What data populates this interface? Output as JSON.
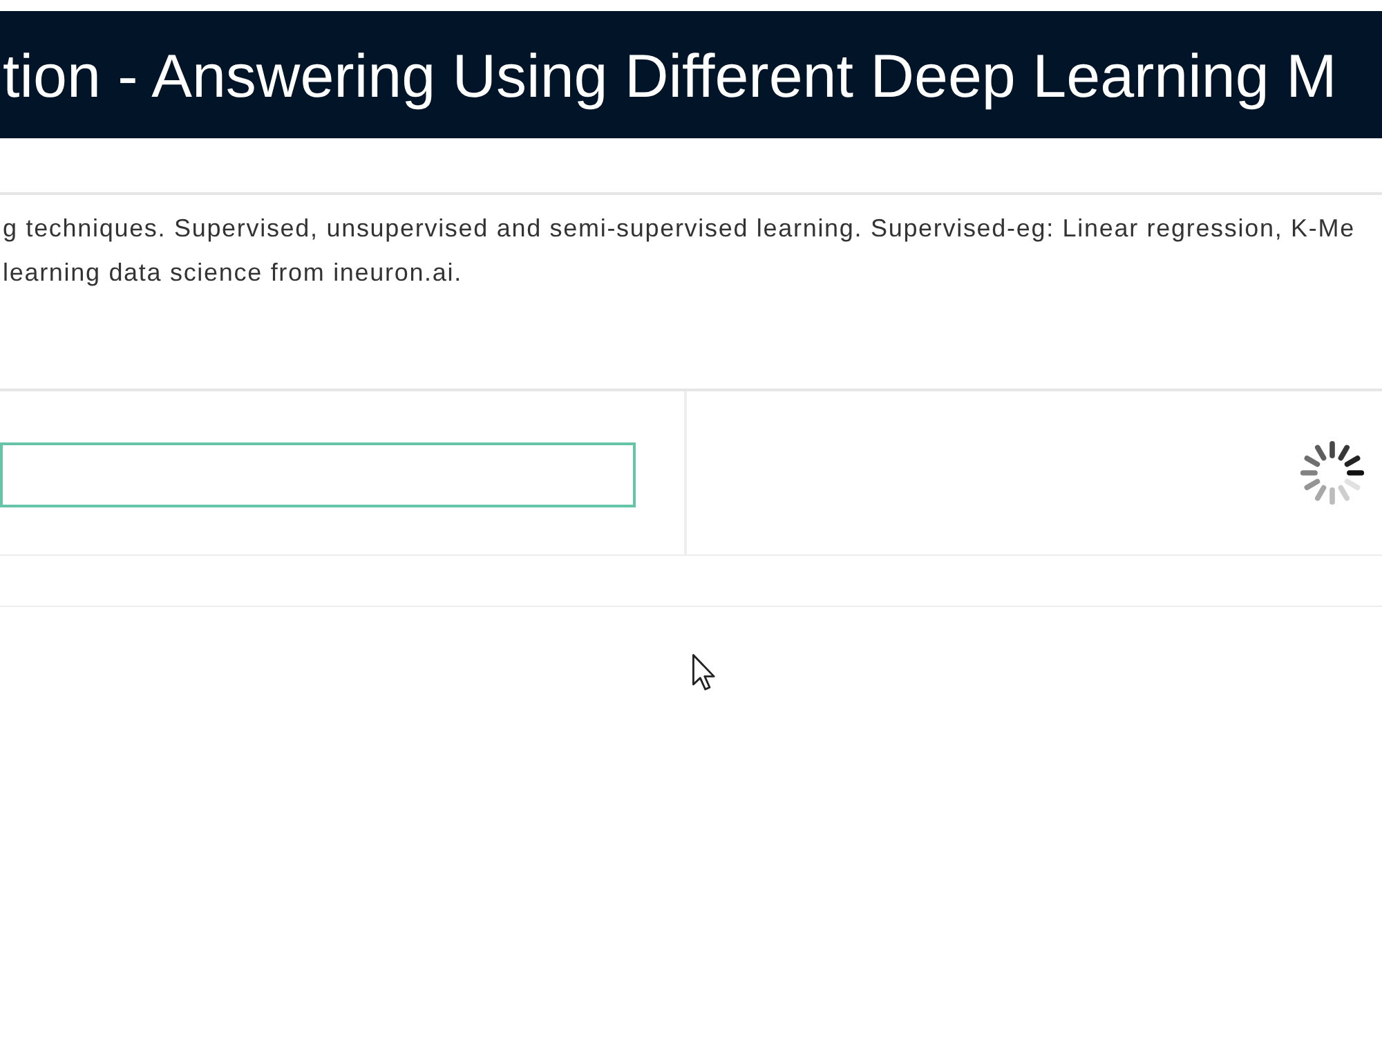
{
  "header": {
    "title": "tion - Answering Using Different Deep Learning M"
  },
  "description": {
    "lines": [
      "g techniques. Supervised, unsupervised and semi-supervised learning. Supervised-eg: Linear regression, K-Me",
      "learning data science from ineuron.ai."
    ]
  },
  "question_panel": {
    "input": {
      "focused": true
    },
    "answer": {
      "loading": true
    }
  }
}
